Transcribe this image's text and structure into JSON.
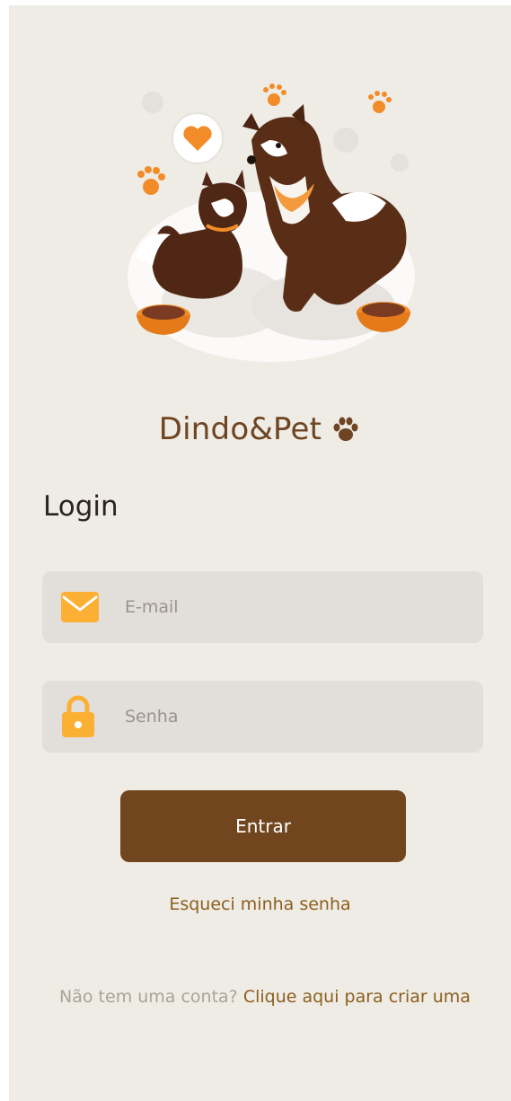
{
  "brand": {
    "name": "Dindo&Pet",
    "paw_icon": "paw-icon",
    "color": "#6e4421"
  },
  "hero": {
    "illustration": "dog-and-cat-illustration"
  },
  "login": {
    "title": "Login",
    "email": {
      "icon": "envelope-icon",
      "placeholder": "E-mail",
      "value": ""
    },
    "password": {
      "icon": "lock-icon",
      "placeholder": "Senha",
      "value": ""
    },
    "submit_label": "Entrar",
    "forgot_label": "Esqueci minha senha"
  },
  "signup": {
    "prompt": "Não tem uma conta?",
    "link_label": "Clique aqui para criar uma"
  },
  "colors": {
    "background": "#efebe5",
    "field_bg": "#e2deda",
    "primary": "#71461f",
    "accent_icon": "#fbb034",
    "link": "#8b5f1d",
    "muted": "#aaa39b"
  }
}
